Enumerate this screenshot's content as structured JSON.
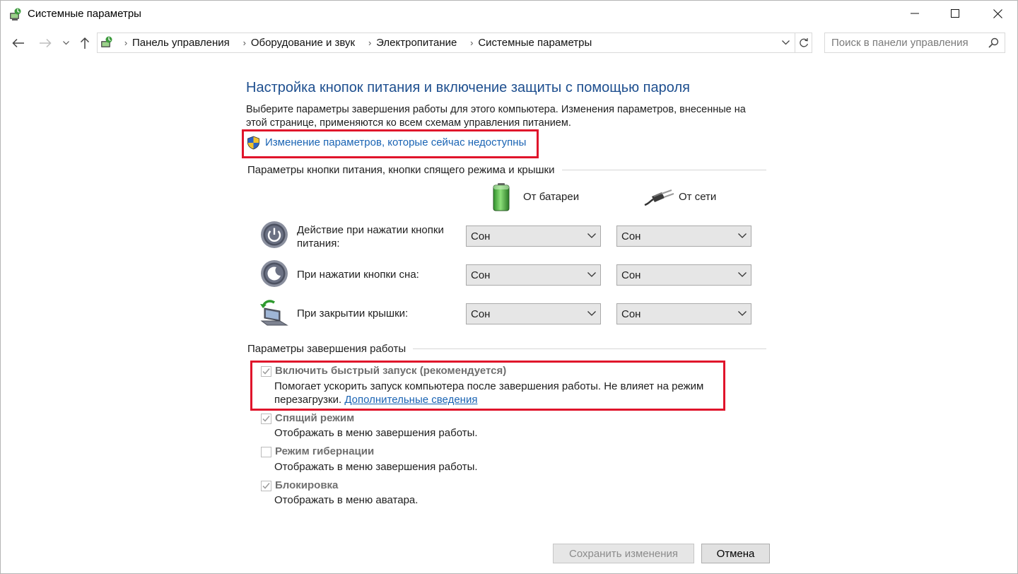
{
  "window": {
    "title": "Системные параметры",
    "controls": {
      "minimize": "minimize-icon",
      "maximize": "maximize-icon",
      "close": "close-icon"
    }
  },
  "nav": {
    "back": "back-arrow-icon",
    "forward": "forward-arrow-icon",
    "recent": "chevron-down-icon",
    "up": "up-arrow-icon",
    "breadcrumbs": [
      "Панель управления",
      "Оборудование и звук",
      "Электропитание",
      "Системные параметры"
    ],
    "search_placeholder": "Поиск в панели управления"
  },
  "content": {
    "title": "Настройка кнопок питания и включение защиты с помощью пароля",
    "description_line1": "Выберите параметры завершения работы для этого компьютера. Изменения параметров, внесенные на",
    "description_line2": "этой странице, применяются ко всем схемам управления питанием.",
    "change_unavailable_link": "Изменение параметров, которые сейчас недоступны",
    "power_section_label": "Параметры кнопки питания, кнопки спящего режима и крышки",
    "columns": {
      "battery": "От батареи",
      "plugged": "От сети"
    },
    "rows": [
      {
        "label_line1": "Действие при нажатии кнопки",
        "label_line2": "питания:",
        "battery": "Сон",
        "plugged": "Сон",
        "icon": "power-button-icon"
      },
      {
        "label_line1": "При нажатии кнопки сна:",
        "label_line2": "",
        "battery": "Сон",
        "plugged": "Сон",
        "icon": "sleep-button-icon"
      },
      {
        "label_line1": "При закрытии крышки:",
        "label_line2": "",
        "battery": "Сон",
        "plugged": "Сон",
        "icon": "laptop-lid-icon"
      }
    ],
    "shutdown_section_label": "Параметры завершения работы",
    "options": [
      {
        "title": "Включить быстрый запуск (рекомендуется)",
        "desc_line1": "Помогает ускорить запуск компьютера после завершения работы. Не влияет на режим",
        "desc_line2": "перезагрузки.",
        "link": "Дополнительные сведения",
        "checked": true
      },
      {
        "title": "Спящий режим",
        "desc_line1": "Отображать в меню завершения работы.",
        "checked": true
      },
      {
        "title": "Режим гибернации",
        "desc_line1": "Отображать в меню завершения работы.",
        "checked": false
      },
      {
        "title": "Блокировка",
        "desc_line1": "Отображать в меню аватара.",
        "checked": true
      }
    ]
  },
  "footer": {
    "save": "Сохранить изменения",
    "cancel": "Отмена"
  },
  "colors": {
    "title_blue": "#1e4f8f",
    "link_blue": "#1a64b4",
    "highlight_red": "#e0142b",
    "disabled_text": "#6f6f6f"
  }
}
